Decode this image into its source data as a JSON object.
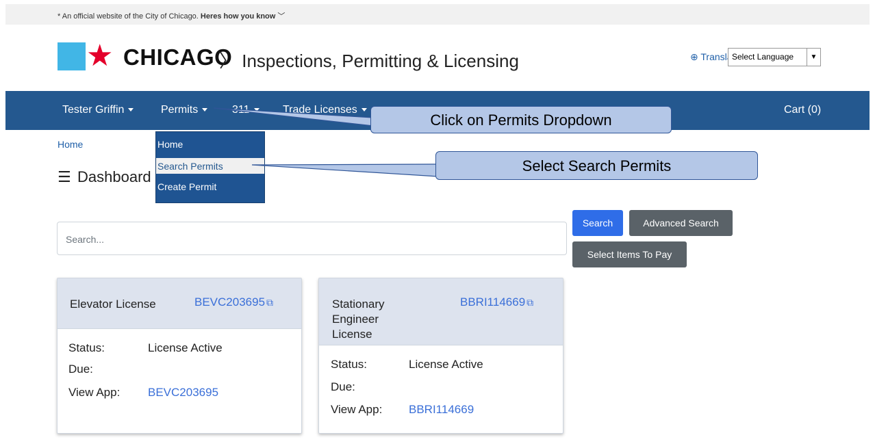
{
  "official_banner": {
    "star": "*",
    "text": "An official website of the City of Chicago.",
    "how_label": "Heres how you know",
    "chevron": "﹀"
  },
  "header": {
    "logo_word": "CHICAGO",
    "separator": "〉",
    "site_title": "Inspections, Permitting & Licensing",
    "translate_label": "Translate",
    "language_select": "Select Language",
    "brand_colors": {
      "blue": "#41b6e6",
      "red": "#e4002b"
    }
  },
  "nav": {
    "user": "Tester Griffin",
    "permits": "Permits",
    "item_311": "311",
    "trade_licenses": "Trade Licenses",
    "cart": "Cart (0)",
    "bar_color": "#24588f"
  },
  "permits_dropdown": {
    "items": [
      "Home",
      "Search Permits",
      "Create Permit"
    ]
  },
  "breadcrumb": "Home",
  "page": {
    "icon": "list-icon",
    "title": "Dashboard"
  },
  "search": {
    "placeholder": "Search...",
    "search_button": "Search",
    "advanced_button": "Advanced Search",
    "pay_button": "Select Items To Pay"
  },
  "cards": [
    {
      "title": "Elevator License",
      "number": "BEVC203695",
      "status_label": "Status:",
      "status_value": "License Active",
      "due_label": "Due:",
      "due_value": "",
      "view_label": "View App:",
      "view_value": "BEVC203695"
    },
    {
      "title": "Stationary Engineer License",
      "number": "BBRI114669",
      "status_label": "Status:",
      "status_value": "License Active",
      "due_label": "Due:",
      "due_value": "",
      "view_label": "View App:",
      "view_value": "BBRI114669"
    }
  ],
  "callouts": {
    "permits": "Click on Permits Dropdown",
    "search_permits": "Select Search Permits"
  }
}
